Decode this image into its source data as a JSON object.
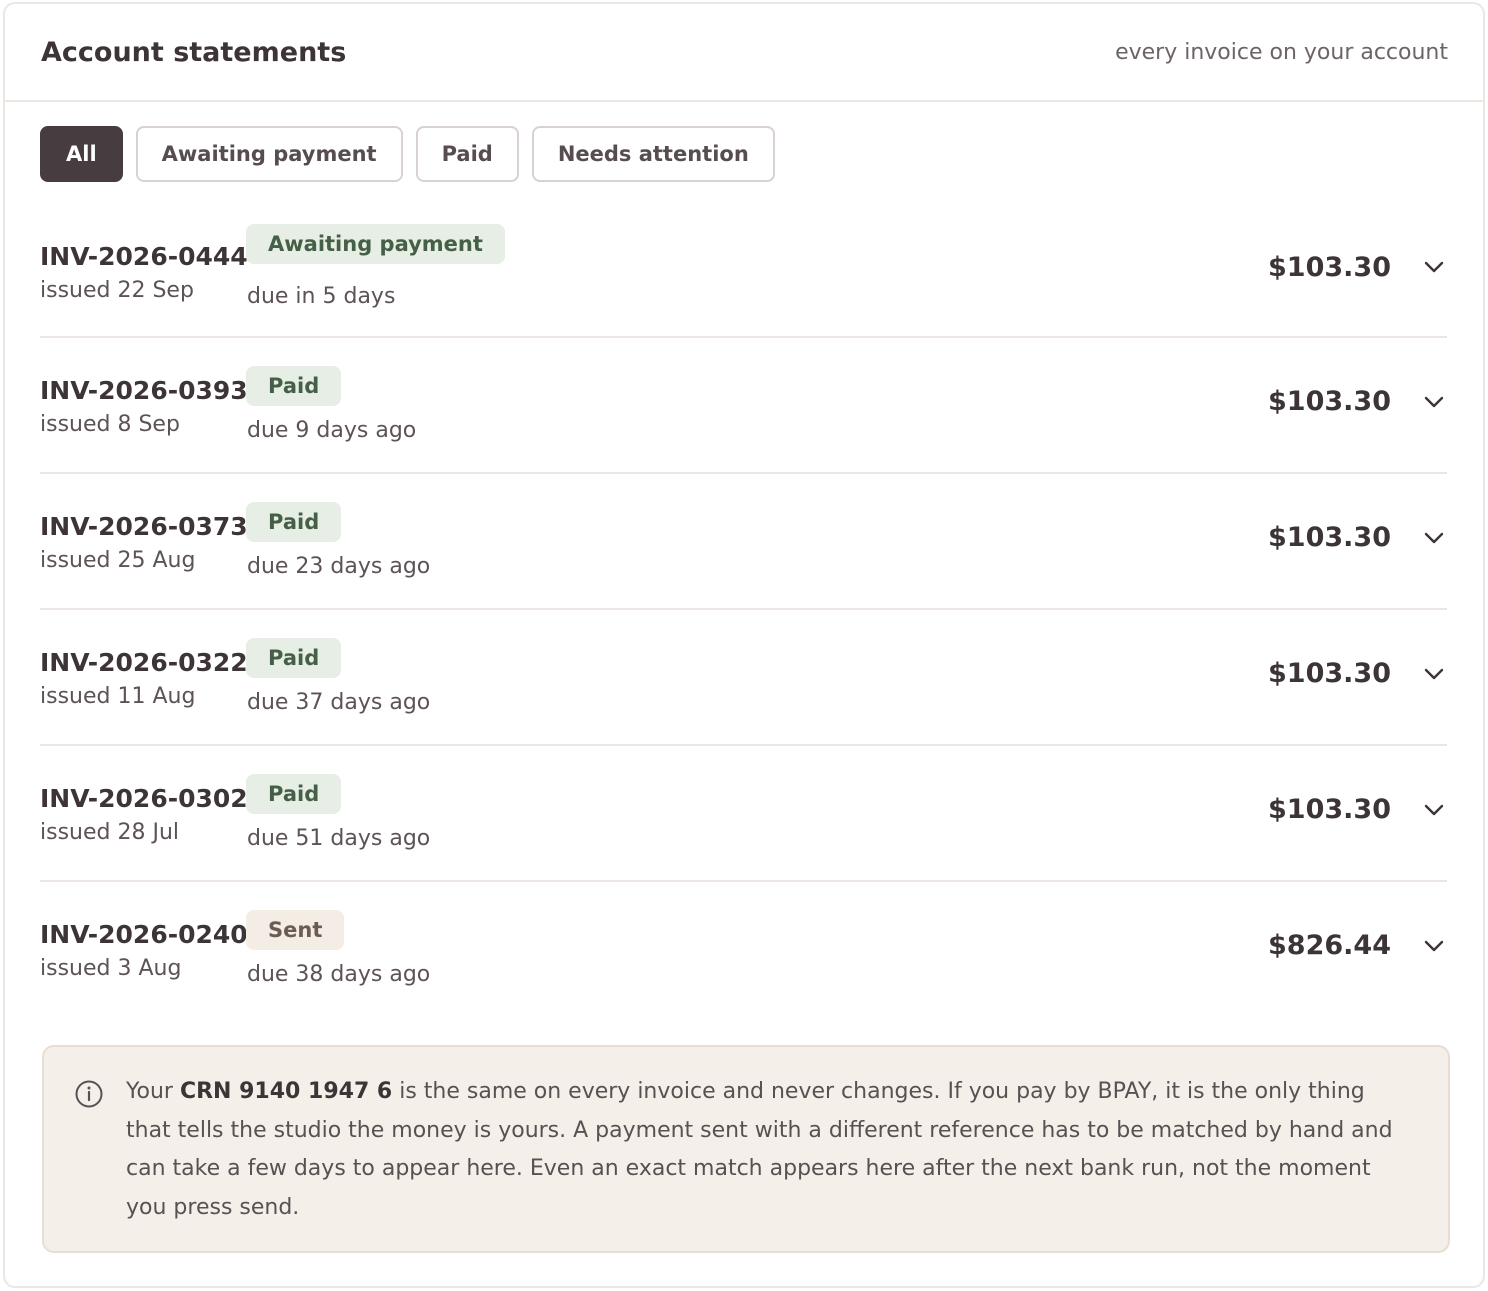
{
  "header": {
    "title": "Account statements",
    "subtitle": "every invoice on your account"
  },
  "filters": [
    {
      "label": "All",
      "active": true
    },
    {
      "label": "Awaiting payment",
      "active": false
    },
    {
      "label": "Paid",
      "active": false
    },
    {
      "label": "Needs attention",
      "active": false
    }
  ],
  "invoices": [
    {
      "id": "INV-2026-0444",
      "issued": "issued 22 Sep",
      "status": "Awaiting payment",
      "status_tone": "green",
      "due": "due in 5 days",
      "amount": "$103.30"
    },
    {
      "id": "INV-2026-0393",
      "issued": "issued 8 Sep",
      "status": "Paid",
      "status_tone": "green",
      "due": "due 9 days ago",
      "amount": "$103.30"
    },
    {
      "id": "INV-2026-0373",
      "issued": "issued 25 Aug",
      "status": "Paid",
      "status_tone": "green",
      "due": "due 23 days ago",
      "amount": "$103.30"
    },
    {
      "id": "INV-2026-0322",
      "issued": "issued 11 Aug",
      "status": "Paid",
      "status_tone": "green",
      "due": "due 37 days ago",
      "amount": "$103.30"
    },
    {
      "id": "INV-2026-0302",
      "issued": "issued 28 Jul",
      "status": "Paid",
      "status_tone": "green",
      "due": "due 51 days ago",
      "amount": "$103.30"
    },
    {
      "id": "INV-2026-0240",
      "issued": "issued 3 Aug",
      "status": "Sent",
      "status_tone": "neutral",
      "due": "due 38 days ago",
      "amount": "$826.44"
    }
  ],
  "notice": {
    "icon": "info-icon",
    "prefix": "Your ",
    "crn": "CRN 9140 1947 6",
    "body": " is the same on every invoice and never changes. If you pay by BPAY, it is the only thing that tells the studio the money is yours. A payment sent with a different reference has to be matched by hand and can take a few days to appear here. Even an exact match appears here after the next bank run, not the moment you press send."
  },
  "colors": {
    "accent_dark": "#473c40",
    "badge_green_bg": "#e6eee5",
    "badge_green_text": "#456046",
    "badge_neutral_bg": "#f4ede6",
    "notice_bg": "#f5efe9"
  }
}
